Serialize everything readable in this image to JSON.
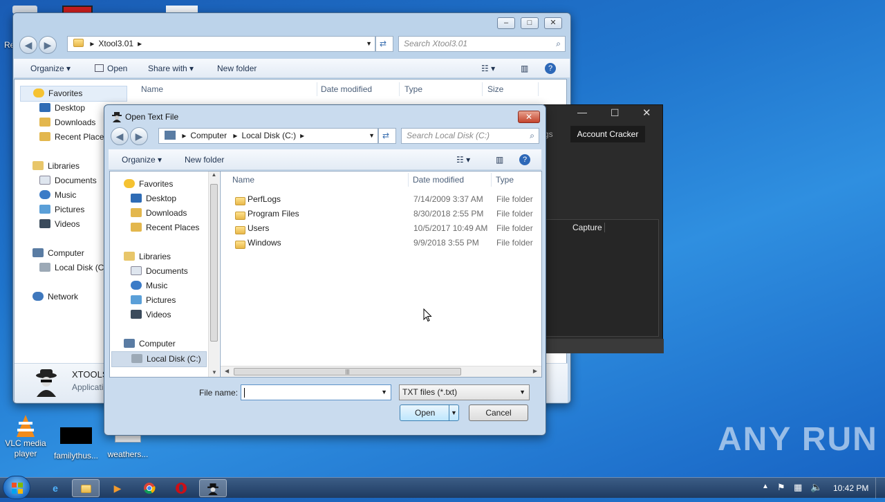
{
  "desktop": {
    "icons": [
      {
        "label": "VLC media player"
      },
      {
        "label": "familythus..."
      },
      {
        "label": "weathers..."
      }
    ],
    "edge_text": "Re"
  },
  "explorer": {
    "address": {
      "segments": [
        "Xtool3.01"
      ]
    },
    "search_placeholder": "Search Xtool3.01",
    "toolbar": {
      "organize": "Organize",
      "open": "Open",
      "share_with": "Share with",
      "new_folder": "New folder"
    },
    "nav": {
      "favorites": "Favorites",
      "favorites_items": [
        "Desktop",
        "Downloads",
        "Recent Places"
      ],
      "libraries": "Libraries",
      "libraries_items": [
        "Documents",
        "Music",
        "Pictures",
        "Videos"
      ],
      "computer": "Computer",
      "computer_items": [
        "Local Disk (C:)"
      ],
      "network": "Network"
    },
    "columns": {
      "name": "Name",
      "date": "Date modified",
      "type": "Type",
      "size": "Size"
    },
    "details": {
      "name": "XTOOLS",
      "kind": "Applicati"
    }
  },
  "dark_app": {
    "tab_partial": "gs",
    "tab_active": "Account Cracker",
    "capture_label": "Capture"
  },
  "dialog": {
    "title": "Open Text File",
    "address": {
      "segments": [
        "Computer",
        "Local Disk (C:)"
      ]
    },
    "search_placeholder": "Search Local Disk (C:)",
    "toolbar": {
      "organize": "Organize",
      "new_folder": "New folder"
    },
    "nav": {
      "favorites": "Favorites",
      "favorites_items": [
        "Desktop",
        "Downloads",
        "Recent Places"
      ],
      "libraries": "Libraries",
      "libraries_items": [
        "Documents",
        "Music",
        "Pictures",
        "Videos"
      ],
      "computer": "Computer",
      "computer_items": [
        "Local Disk (C:)"
      ]
    },
    "columns": {
      "name": "Name",
      "date": "Date modified",
      "type": "Type"
    },
    "files": [
      {
        "name": "PerfLogs",
        "date": "7/14/2009 3:37 AM",
        "type": "File folder"
      },
      {
        "name": "Program Files",
        "date": "8/30/2018 2:55 PM",
        "type": "File folder"
      },
      {
        "name": "Users",
        "date": "10/5/2017 10:49 AM",
        "type": "File folder"
      },
      {
        "name": "Windows",
        "date": "9/9/2018 3:55 PM",
        "type": "File folder"
      }
    ],
    "filename_label": "File name:",
    "filename_value": "",
    "filter": "TXT files (*.txt)",
    "open_button": "Open",
    "cancel_button": "Cancel"
  },
  "taskbar": {
    "clock": "10:42 PM"
  },
  "watermark": "ANY RUN",
  "colors": {
    "taskbar": "#2a4a73",
    "selected": "#cce4f7",
    "dark_app": "#2b2b2b"
  }
}
